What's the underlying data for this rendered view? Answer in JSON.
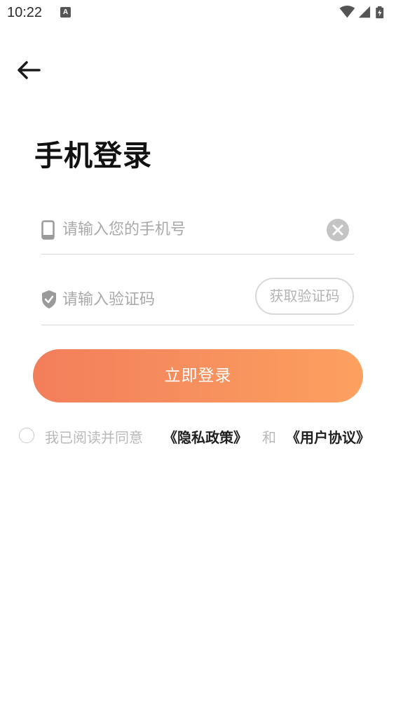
{
  "status_bar": {
    "time": "10:22",
    "notification_badge": "A"
  },
  "header": {
    "title": "手机登录"
  },
  "form": {
    "phone_placeholder": "请输入您的手机号",
    "code_placeholder": "请输入验证码",
    "get_code_label": "获取验证码",
    "login_label": "立即登录"
  },
  "agreement": {
    "prefix": "我已阅读并同意",
    "privacy_link": "《隐私政策》",
    "conjunction": "和",
    "terms_link": "《用户协议》"
  },
  "colors": {
    "button_gradient_start": "#f27e5a",
    "button_gradient_end": "#fda05f",
    "placeholder": "#a9a9a9",
    "link_text": "#1f1f1f"
  },
  "icons": {
    "back": "arrow-left-icon",
    "phone": "mobile-phone-icon",
    "shield": "shield-check-icon",
    "clear": "clear-circle-icon",
    "wifi": "wifi-icon",
    "signal": "signal-icon",
    "battery": "battery-charging-icon"
  }
}
